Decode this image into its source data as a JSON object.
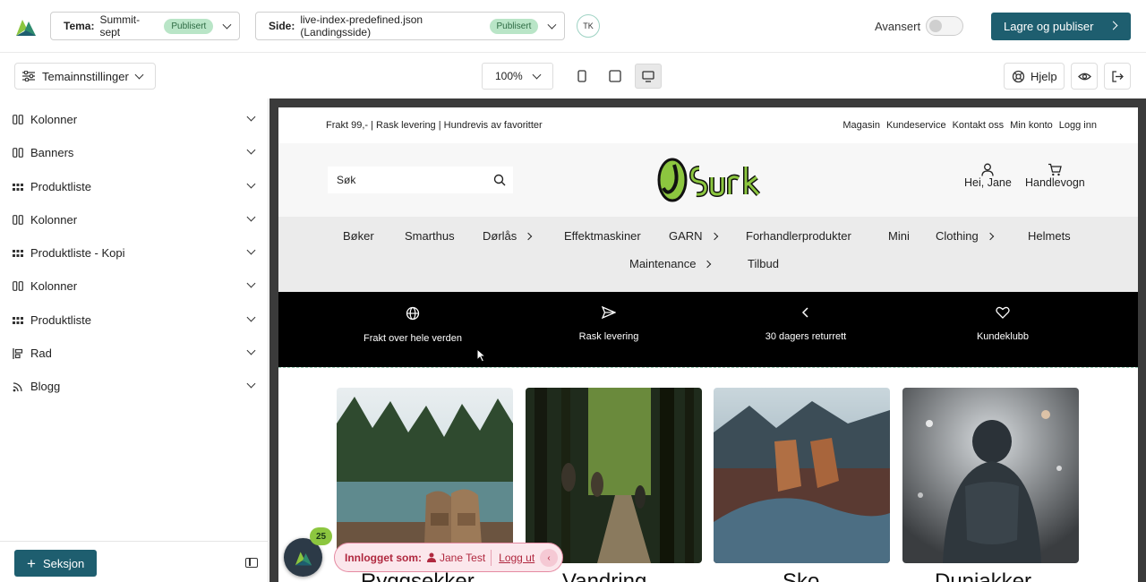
{
  "topbar": {
    "theme_label": "Tema:",
    "theme_value": "Summit-sept",
    "theme_status": "Publisert",
    "page_label": "Side:",
    "page_value": "live-index-predefined.json (Landingsside)",
    "page_status": "Publisert",
    "user_initials": "TK",
    "advanced_label": "Avansert",
    "publish_label": "Lagre og publiser"
  },
  "toolbar": {
    "theme_settings_label": "Temainnstillinger",
    "zoom_value": "100%",
    "help_label": "Hjelp"
  },
  "sidebar": {
    "items": [
      {
        "label": "Kolonner",
        "icon": "columns-icon"
      },
      {
        "label": "Banners",
        "icon": "columns-icon"
      },
      {
        "label": "Produktliste",
        "icon": "grid-icon"
      },
      {
        "label": "Kolonner",
        "icon": "columns-icon"
      },
      {
        "label": "Produktliste - Kopi",
        "icon": "grid-icon"
      },
      {
        "label": "Kolonner",
        "icon": "columns-icon"
      },
      {
        "label": "Produktliste",
        "icon": "grid-icon"
      },
      {
        "label": "Rad",
        "icon": "row-icon"
      },
      {
        "label": "Blogg",
        "icon": "rss-icon"
      }
    ],
    "add_section_label": "Seksjon"
  },
  "preview": {
    "announcement": "Frakt 99,- | Rask levering | Hundrevis av favoritter",
    "top_links": [
      "Magasin",
      "Kundeservice",
      "Kontakt oss",
      "Min konto",
      "Logg inn"
    ],
    "search_placeholder": "Søk",
    "account_label": "Hei, Jane",
    "cart_label": "Handlevogn",
    "nav": [
      {
        "label": "Bøker"
      },
      {
        "label": "Smarthus"
      },
      {
        "label": "Dørlås"
      },
      {
        "label": "Effektmaskiner"
      },
      {
        "label": "GARN"
      },
      {
        "label": "Forhandlerprodukter"
      },
      {
        "label": "Mini"
      },
      {
        "label": "Clothing"
      },
      {
        "label": "Helmets"
      },
      {
        "label": "Maintenance"
      },
      {
        "label": "Tilbud"
      }
    ],
    "usps": [
      {
        "label": "Frakt over hele verden",
        "icon": "globe-icon"
      },
      {
        "label": "Rask levering",
        "icon": "send-icon"
      },
      {
        "label": "30 dagers returrett",
        "icon": "chevron-left-icon"
      },
      {
        "label": "Kundeklubb",
        "icon": "heart-icon"
      }
    ],
    "cards": [
      {
        "title": "Ryggsekker"
      },
      {
        "title": "Vandring"
      },
      {
        "title": "Sko"
      },
      {
        "title": "Dunjakker"
      }
    ]
  },
  "floating": {
    "badge_count": "25",
    "logged_in_label": "Innlogget som:",
    "user_name": "Jane Test",
    "logout_label": "Logg ut"
  },
  "colors": {
    "primary": "#1e5e6f",
    "badge_green": "#b9e5c7",
    "accent_lime": "#8cc63f",
    "login_pink": "#fbe7ec"
  }
}
